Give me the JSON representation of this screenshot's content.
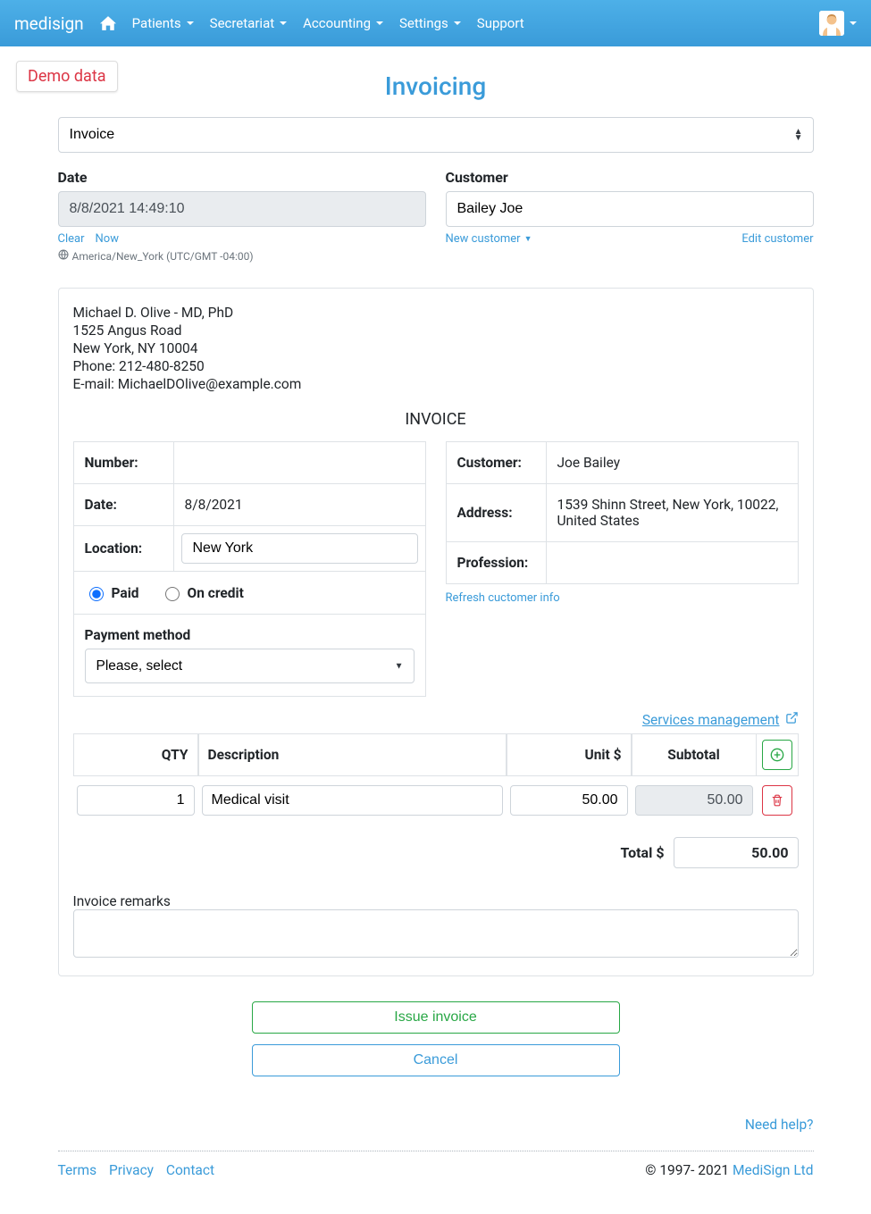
{
  "nav": {
    "brand": "medisign",
    "items": [
      "Patients",
      "Secretariat",
      "Accounting",
      "Settings",
      "Support"
    ]
  },
  "demo_badge": "Demo data",
  "page_title": "Invoicing",
  "doc_type_select": "Invoice",
  "date": {
    "label": "Date",
    "value": "8/8/2021 14:49:10",
    "clear": "Clear",
    "now": "Now",
    "tz": "America/New_York (UTC/GMT -04:00)"
  },
  "customer": {
    "label": "Customer",
    "value": "Bailey Joe",
    "new_link": "New customer",
    "edit_link": "Edit customer"
  },
  "sender": {
    "line1": "Michael D. Olive - MD, PhD",
    "line2": "1525 Angus Road",
    "line3": "New York, NY 10004",
    "line4": "Phone: 212-480-8250",
    "line5": "E-mail: MichaelDOlive@example.com"
  },
  "invoice_heading": "INVOICE",
  "left_table": {
    "number_label": "Number:",
    "number_value": "",
    "date_label": "Date:",
    "date_value": "8/8/2021",
    "location_label": "Location:",
    "location_value": "New York",
    "paid_label": "Paid",
    "credit_label": "On credit",
    "payment_method_label": "Payment method",
    "payment_method_value": "Please, select"
  },
  "right_table": {
    "customer_label": "Customer:",
    "customer_value": "Joe Bailey",
    "address_label": "Address:",
    "address_value": "1539 Shinn Street, New York, 10022, United States",
    "profession_label": "Profession:",
    "profession_value": ""
  },
  "refresh_link": "Refresh cuctomer info",
  "services_link": "Services management ",
  "items_header": {
    "qty": "QTY",
    "desc": "Description",
    "unit": "Unit $",
    "subtotal": "Subtotal"
  },
  "items": [
    {
      "qty": "1",
      "desc": "Medical visit",
      "unit": "50.00",
      "subtotal": "50.00"
    }
  ],
  "total_label": "Total $",
  "total_value": "50.00",
  "remarks_label": "Invoice remarks",
  "buttons": {
    "issue": "Issue invoice",
    "cancel": "Cancel"
  },
  "need_help": "Need help?",
  "footer": {
    "terms": "Terms",
    "privacy": "Privacy",
    "contact": "Contact",
    "copyright": "© 1997- 2021 ",
    "company": "MediSign Ltd"
  }
}
